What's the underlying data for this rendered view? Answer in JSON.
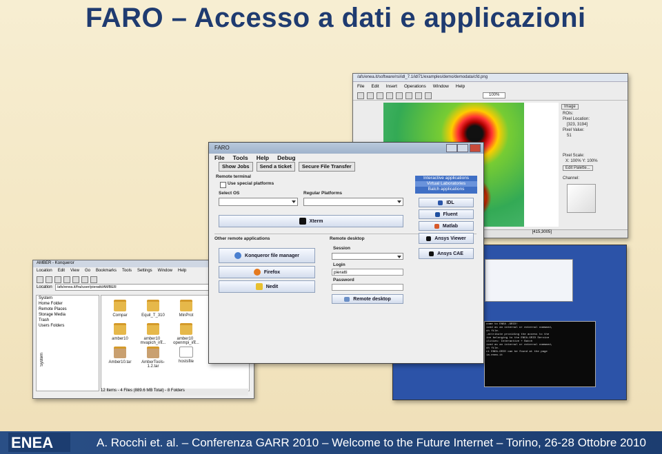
{
  "slide": {
    "title": "FARO – Accesso a dati e applicazioni",
    "footer": "A. Rocchi et. al. – Conferenza GARR 2010 – Welcome to the Future Internet – Torino, 26-28 Ottobre 2010",
    "logo": "ENEA"
  },
  "idl": {
    "title": "/afs/enea.it/software/rsi/idl_7.1/idl71/examples/demo/demodata/cfd.png",
    "menu": [
      "File",
      "Edit",
      "Insert",
      "Operations",
      "Window",
      "Help"
    ],
    "zoom": "100%",
    "panel": {
      "image_tab": "Image",
      "rois": "ROIs:",
      "pixel_location": "Pixel Location:",
      "location_value": "[323, 3194]",
      "pixel_value": "Pixel Value:",
      "value": "51",
      "pixel_scale": "Pixel Scale:",
      "scale_value": "X: 100%   Y: 100%",
      "edit_palette": "Edit Palette...",
      "channel": "Channel:"
    },
    "status": "[415,3005]"
  },
  "konqueror": {
    "title": "AMBER - Konqueror",
    "menu": [
      "Location",
      "Edit",
      "View",
      "Go",
      "Bookmarks",
      "Tools",
      "Settings",
      "Window",
      "Help"
    ],
    "location_label": "Location",
    "location_value": "/afs/enea.it/fra/user/pieratti/AMBER",
    "tree": [
      "System",
      "Home Folder",
      "Remote Places",
      "Storage Media",
      "Trash",
      "Users Folders"
    ],
    "side_tab": "System",
    "files": [
      "Compar",
      "Equil_T_310",
      "MinProt",
      "amber10",
      "amber10_ mvapich_int...",
      "amber10_ openmpi_int...",
      "Amber10.tar",
      "AmberTools-1.2.tar",
      "hostsfile"
    ],
    "statusbar": "12 Items - 4 Files (889.6 MB Total) - 8 Folders"
  },
  "faro": {
    "title": "FARO",
    "menu": [
      "File",
      "Tools",
      "Help",
      "Debug"
    ],
    "tabs": [
      "Show Jobs",
      "Send a ticket",
      "Secure File Transfer"
    ],
    "remote_terminal": "Remote terminal",
    "use_special": "Use special platforms",
    "select_os": "Select OS",
    "regular_platforms": "Regular Platforms",
    "xterm": "Xterm",
    "other_apps": "Other remote applications",
    "konqueror": "Konqueror file manager",
    "firefox": "Firefox",
    "nedit": "Nedit",
    "remote_desktop": "Remote desktop",
    "session": "Session",
    "login": "Login",
    "login_value": "pieratti",
    "password": "Password",
    "remote_desktop_btn": "Remote desktop",
    "right_panel": [
      "Interactive applications",
      "Virtual Laboratories",
      "Batch applications"
    ],
    "apps": [
      "IDL",
      "Fluent",
      "Matlab",
      "Ansys Viewer",
      "Ansys CAE"
    ]
  },
  "terminal": {
    "lines": [
      "come to ENEA -GRID!",
      "ized as an internal or external command,",
      "ch file.",
      "-attribute providing the access to the",
      "ice belonging to the ENEA-GRID Service",
      "ilities: Interactive + Batch",
      "ized as an internal or external command,",
      "ch file.",
      "ct ENEA-GRID can be found at the page",
      "ia.enea.it"
    ]
  }
}
